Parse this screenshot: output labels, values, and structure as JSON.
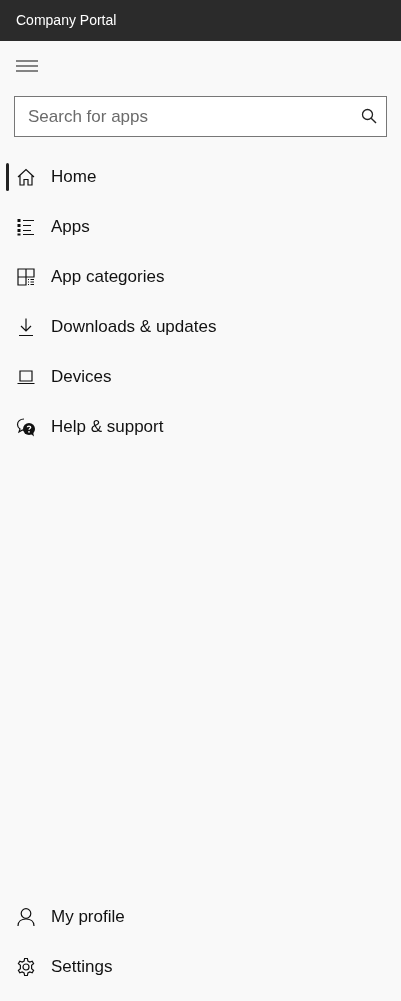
{
  "window": {
    "title": "Company Portal"
  },
  "search": {
    "placeholder": "Search for apps"
  },
  "nav": [
    {
      "kind": "home",
      "label": "Home",
      "selected": true
    },
    {
      "kind": "list",
      "label": "Apps",
      "selected": false
    },
    {
      "kind": "grid",
      "label": "App categories",
      "selected": false
    },
    {
      "kind": "download",
      "label": "Downloads & updates",
      "selected": false
    },
    {
      "kind": "laptop",
      "label": "Devices",
      "selected": false
    },
    {
      "kind": "chat",
      "label": "Help & support",
      "selected": false
    }
  ],
  "footer_nav": [
    {
      "kind": "person",
      "label": "My profile",
      "selected": false
    },
    {
      "kind": "gear",
      "label": "Settings",
      "selected": false
    }
  ]
}
